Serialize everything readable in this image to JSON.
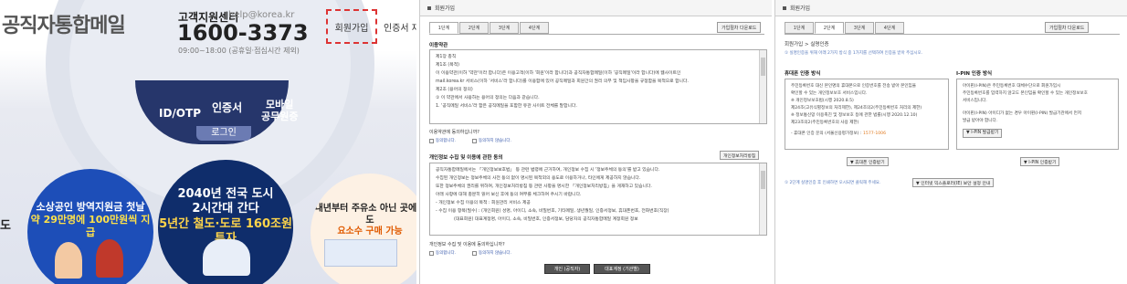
{
  "left": {
    "brand": "공직자통합메일",
    "cs_label": "고객지원센터",
    "cs_email": "help@korea.kr",
    "cs_phone": "1600-3373",
    "cs_hours": "09:00~18:00 (공휴일·점심시간 제외)",
    "join": "회원가입",
    "cert": "인증서 재등",
    "menu": {
      "idotp": "ID/OTP",
      "cert": "인증서",
      "mobile_1": "모바일",
      "mobile_2": "공무원증",
      "login": "로그인"
    },
    "banners": {
      "b1_line1": "소상공인 방역지원금 첫날",
      "b1_line2": "약 29만명에 100만원씩 지급",
      "b2_line1": "2040년 전국 도시",
      "b2_line2": "2시간대 간다",
      "b2_line3": "5년간 철도·도로 160조원 투자",
      "b3_line1": "내년부터 주유소 아닌 곳에서도",
      "b3_line2": "요소수 구매 가능",
      "edge": "도"
    }
  },
  "mid": {
    "title": "회원가입",
    "tabs": [
      "1단계",
      "2단계",
      "3단계",
      "4단계"
    ],
    "download": "가입절차 다운로드",
    "terms_title": "이용약관",
    "terms_lines": [
      "제1장 총칙",
      "제1조 (목적)",
      "이 이용약관(이하 '약관'이라 합니다)은 이용고객(이하 '회원'이라 합니다)과 공직자통합메일(이하 '공직메일'이라 합니다)에 웹사이트인",
      "mail.korea.kr 서비스(이하 '서비스'라 합니다)를 이용함에 있어 공직메일과 회원간의 권리 의무 및 책임사항을 규정함을 목적으로 합니다.",
      "제2조 (용어의 정의)",
      "① 이 약관에서 사용하는 용어의 정의는 다음과 같습니다.",
      "1. '공직메일 서비스'라 함은 공직메일을 포함한 유관 사이트 전체를 말합니다."
    ],
    "terms_q": "이용약관에 동의하십니까?",
    "agree": "동의합니다.",
    "disagree": "동의하지 않습니다.",
    "privacy_title": "개인정보 수집 및 이용에 관한 동의",
    "privacy_btn": "개인정보처리방침",
    "privacy_lines": [
      "공직자통합메일에서는 「개인정보보호법」 등 관련 법령에 근거하여, 개인정보 수집 시 '정보주체의 동의'를 받고 있습니다.",
      "수집된 개인정보는 정보주체의 사전 동의 없이 명시된 목적외의 용도로 이용하거나, 타인에게 제공하지 않습니다.",
      "또한 정보주체의 권리를 위하여, 개인정보처리방침 등 관련 사항을 명시한 「개인정보처리방침」을 게재하고 있습니다.",
      "아래 사항에 대해 충분히 읽어 보신 후에 동의 여부를 체크하여 주시기 바랍니다.",
      "- 개인정보 수집 이용의 목적 : 회원관리 서비스 제공",
      "- 수집 이용 항목(필수) : (개인회원) 성명, 아이디, 소속, 비밀번호, 기타메일, 생년월일, 인증서정보, 휴대폰번호, 전화번호(직장)",
      "(대표회원) 대표계정명, 아이디, 소속, 비밀번호, 인증서정보, 담당자의 공직자통합메일 계정회원 정보"
    ],
    "privacy_q": "개인정보 수집 및 이용에 동의하십니까?",
    "btn_personal": "개인 (공직자)",
    "btn_rep": "대표계정 (기관별)"
  },
  "right": {
    "title": "회원가입",
    "tabs": [
      "1단계",
      "2단계",
      "3단계",
      "4단계"
    ],
    "download": "가입절차 다운로드",
    "breadcrumb": "회원가입 > 실명인증",
    "notice": "① 실명인증을 위해 아래 2가지 방식 중 1가지를 선택하여 인증을 받아 주십시오.",
    "phone_title": "휴대폰 인증 방식",
    "phone_lines": [
      "주민등록번호 대신 본인명의 휴대폰으로 인증번호를 전송 받아 본인임을",
      "확인할 수 있는 개인정보보호 서비스입니다.",
      "",
      "※ 개인정보보호법(시행 2020.8.5)",
      "제24조(고유식별정보의 처리제한), 제24조의2(주민등록번호 처리의 제한)",
      "※ 정보통신망 이용촉진 및 정보보호 등에 관한 법률(시행 2020.12.10)",
      "제23조의2(주민등록번호의 사용 제한)",
      "",
      "- 휴대폰 인증 문의 (서울신용평가정보) :"
    ],
    "phone_tel": "1577-1006",
    "ipin_title": "I-PIN 인증 방식",
    "ipin_lines": [
      "아이핀(I-PIN)은 주민등록번호 대체수단으로 회원가입시",
      "주민등록번호를 입력하지 않고도 본인임을 확인할 수 있는 개인정보보호",
      "서비스입니다.",
      "",
      "아이핀(I-PIN) 아이디가 없는 경우 아이핀(I-PIN) 발급기관에서 먼저",
      "발급 받아야 합니다."
    ],
    "ipin_issue_btn": "▼ I-PIN 발급받기",
    "phone_btn": "▼ 휴대폰 인증받기",
    "ipin_btn": "▼ I-PIN 인증받기",
    "footnote": "① 2단계 실명인증 후 인쇄하면 오시되면 클릭해 주세요.",
    "security_btn": "▼ 인터넷 익스플로러(IE) 보안 설정 안내"
  }
}
